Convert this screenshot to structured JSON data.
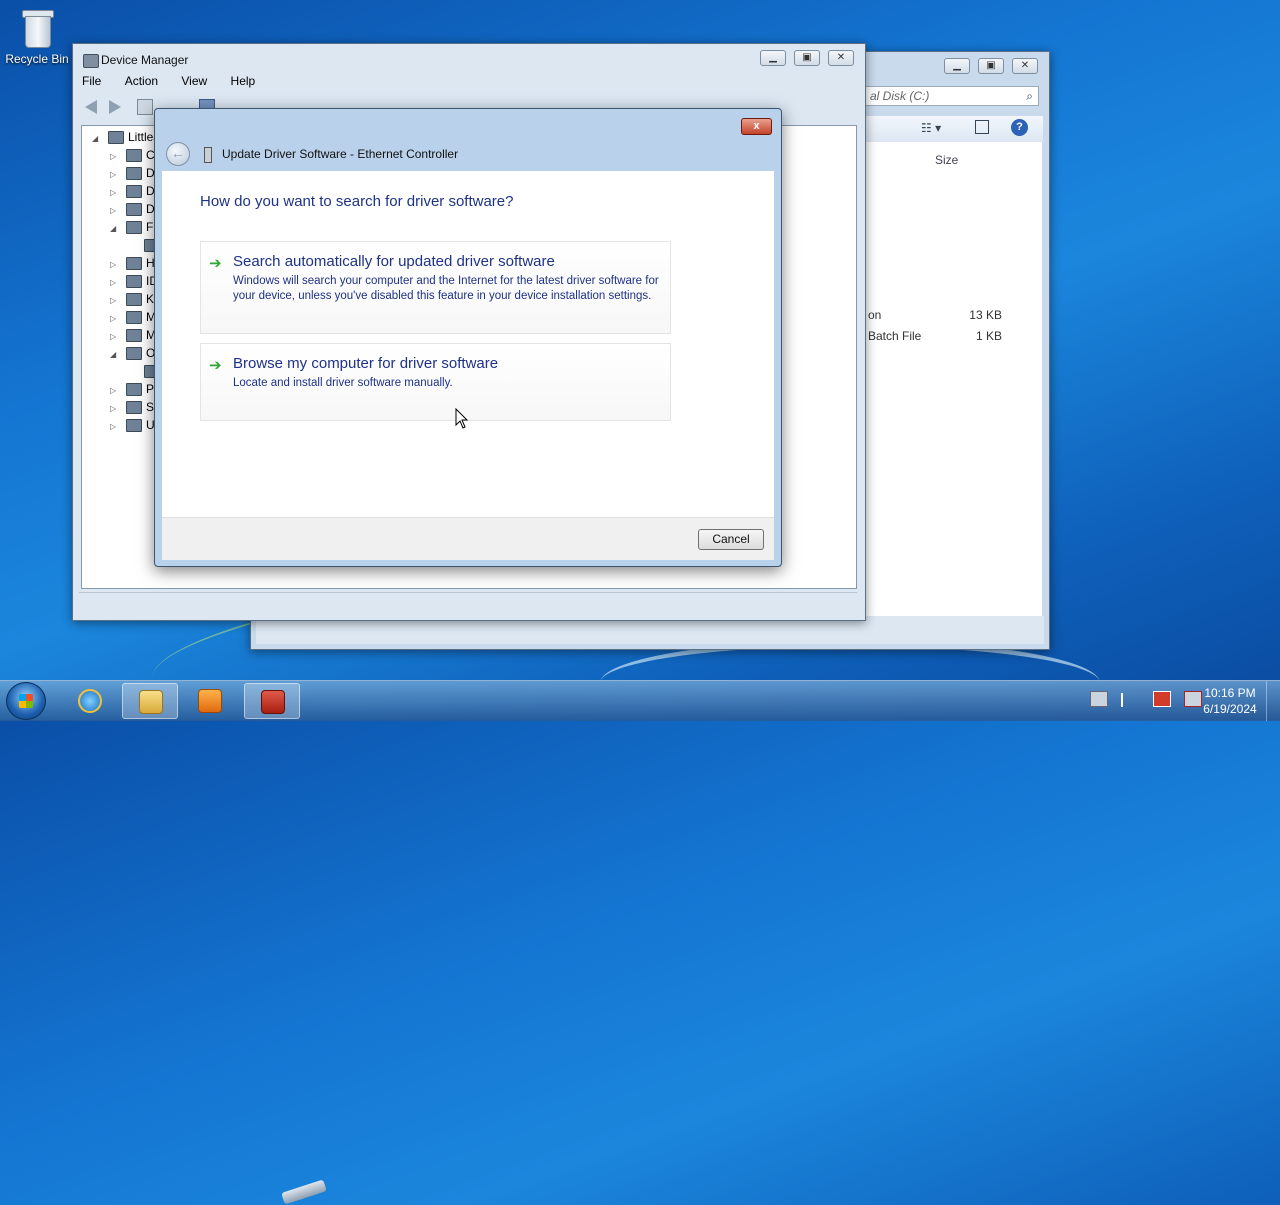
{
  "desktop": {
    "recycle_bin_label": "Recycle Bin"
  },
  "explorer": {
    "address_text": "al Disk (C:)",
    "size_header": "Size",
    "rows": [
      {
        "type": "on",
        "size": "13 KB"
      },
      {
        "type": "Batch File",
        "size": "1 KB"
      }
    ]
  },
  "device_manager": {
    "title": "Device Manager",
    "menu": [
      "File",
      "Action",
      "View",
      "Help"
    ],
    "tree": [
      {
        "label": "LittleJ",
        "twisty": "◢",
        "indent": 0
      },
      {
        "label": "Co",
        "twisty": "▷",
        "indent": 1
      },
      {
        "label": "Di",
        "twisty": "▷",
        "indent": 1
      },
      {
        "label": "Di",
        "twisty": "▷",
        "indent": 1
      },
      {
        "label": "DV",
        "twisty": "▷",
        "indent": 1
      },
      {
        "label": "Fl",
        "twisty": "◢",
        "indent": 1
      },
      {
        "label": "",
        "twisty": "",
        "indent": 2
      },
      {
        "label": "Hu",
        "twisty": "▷",
        "indent": 1
      },
      {
        "label": "ID",
        "twisty": "▷",
        "indent": 1
      },
      {
        "label": "Ke",
        "twisty": "▷",
        "indent": 1
      },
      {
        "label": "Mi",
        "twisty": "▷",
        "indent": 1
      },
      {
        "label": "Mo",
        "twisty": "▷",
        "indent": 1
      },
      {
        "label": "Ot",
        "twisty": "◢",
        "indent": 1
      },
      {
        "label": "",
        "twisty": "",
        "indent": 2
      },
      {
        "label": "Pr",
        "twisty": "▷",
        "indent": 1
      },
      {
        "label": "Sy",
        "twisty": "▷",
        "indent": 1
      },
      {
        "label": "Ur",
        "twisty": "▷",
        "indent": 1
      }
    ]
  },
  "dialog": {
    "title": "Update Driver Software - Ethernet Controller",
    "close_glyph": "x",
    "back_glyph": "←",
    "question": "How do you want to search for driver software?",
    "options": [
      {
        "title": "Search automatically for updated driver software",
        "description": "Windows will search your computer and the Internet for the latest driver software for your device, unless you've disabled this feature in your device installation settings."
      },
      {
        "title": "Browse my computer for driver software",
        "description": "Locate and install driver software manually."
      }
    ],
    "cancel_label": "Cancel"
  },
  "taskbar": {
    "clock_time": "10:16 PM",
    "clock_date": "6/19/2024"
  },
  "colors": {
    "link_blue": "#1e3287",
    "arrow_green": "#2fa62f",
    "desktop_blue": "#1476d2"
  }
}
